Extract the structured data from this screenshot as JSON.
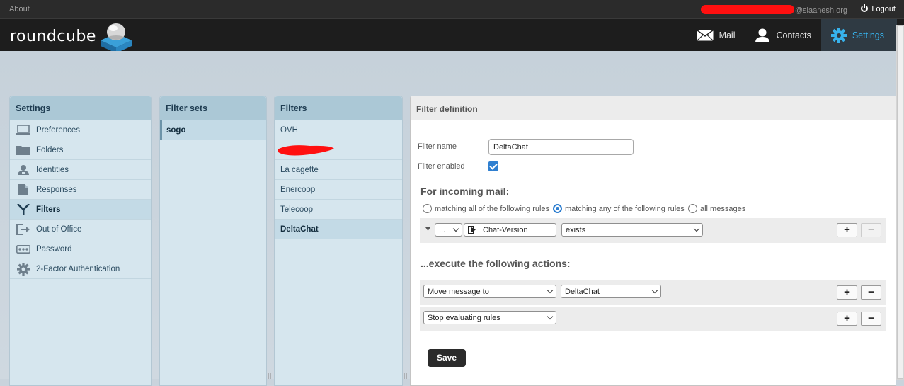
{
  "topbar": {
    "about": "About",
    "user_suffix": "@slaanesh.org",
    "logout": "Logout"
  },
  "header": {
    "logo_text": "roundcube",
    "nav": [
      {
        "label": "Mail",
        "icon": "envelope-icon"
      },
      {
        "label": "Contacts",
        "icon": "person-icon"
      },
      {
        "label": "Settings",
        "icon": "gear-icon",
        "active": true
      }
    ]
  },
  "settings_panel": {
    "title": "Settings",
    "items": [
      {
        "label": "Preferences",
        "icon": "laptop-icon"
      },
      {
        "label": "Folders",
        "icon": "folder-icon"
      },
      {
        "label": "Identities",
        "icon": "id-card-icon"
      },
      {
        "label": "Responses",
        "icon": "document-icon"
      },
      {
        "label": "Filters",
        "icon": "filter-icon",
        "selected": true
      },
      {
        "label": "Out of Office",
        "icon": "exit-icon"
      },
      {
        "label": "Password",
        "icon": "password-icon"
      },
      {
        "label": "2-Factor Authentication",
        "icon": "cog-icon"
      }
    ]
  },
  "filter_sets_panel": {
    "title": "Filter sets",
    "items": [
      {
        "label": "sogo",
        "selected": true
      }
    ]
  },
  "filters_panel": {
    "title": "Filters",
    "items": [
      {
        "label": "OVH"
      },
      {
        "label": ""
      },
      {
        "label": "La cagette"
      },
      {
        "label": "Enercoop"
      },
      {
        "label": "Telecoop"
      },
      {
        "label": "DeltaChat",
        "selected": true
      }
    ]
  },
  "filter_definition": {
    "title": "Filter definition",
    "name_label": "Filter name",
    "name_value": "DeltaChat",
    "enabled_label": "Filter enabled",
    "enabled": true,
    "incoming_heading": "For incoming mail:",
    "match_options": [
      {
        "label": "matching all of the following rules",
        "checked": false
      },
      {
        "label": "matching any of the following rules",
        "checked": true
      },
      {
        "label": "all messages",
        "checked": false
      }
    ],
    "rule": {
      "header_select": "...",
      "header_value": "Chat-Version",
      "operator": "exists",
      "add": "+",
      "remove": "−"
    },
    "actions_heading": "...execute the following actions:",
    "actions": [
      {
        "type": "Move message to",
        "target": "DeltaChat",
        "add": "+",
        "remove": "−"
      },
      {
        "type": "Stop evaluating rules",
        "add": "+",
        "remove": "−"
      }
    ],
    "save_label": "Save"
  },
  "colors": {
    "accent": "#37b2ec",
    "header_bg": "#1d1d1d",
    "panel_header": "#abc8d6"
  }
}
